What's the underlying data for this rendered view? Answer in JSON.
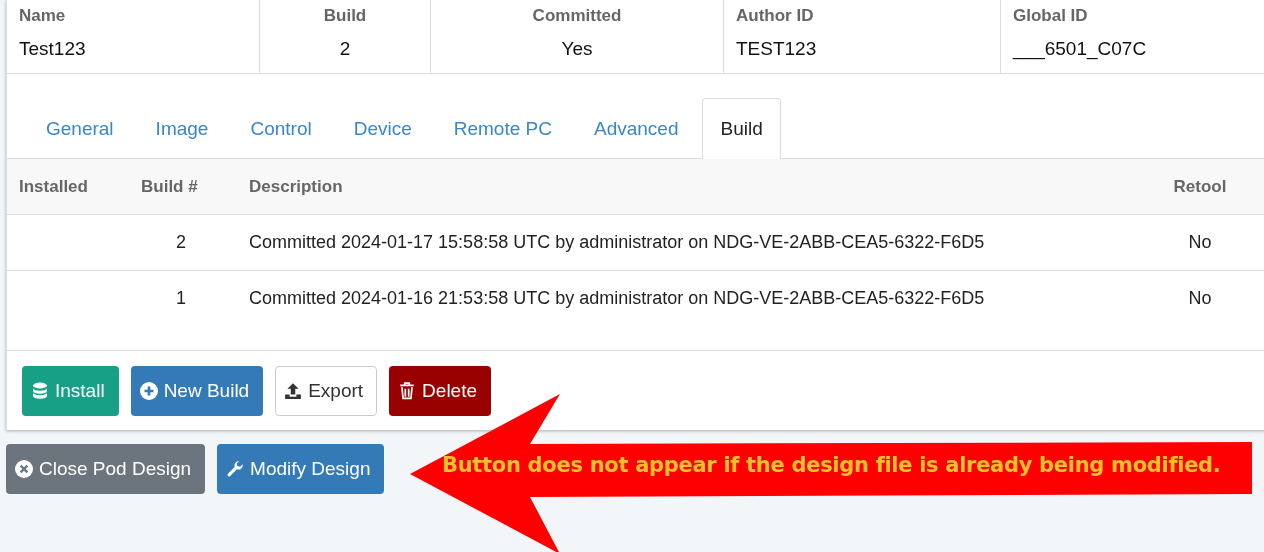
{
  "summary": {
    "columns": [
      {
        "label": "Name",
        "value": "Test123"
      },
      {
        "label": "Build",
        "value": "2"
      },
      {
        "label": "Committed",
        "value": "Yes"
      },
      {
        "label": "Author ID",
        "value": "TEST123"
      },
      {
        "label": "Global ID",
        "value": "___6501_C07C"
      }
    ]
  },
  "tabs": [
    {
      "label": "General",
      "selected": false
    },
    {
      "label": "Image",
      "selected": false
    },
    {
      "label": "Control",
      "selected": false
    },
    {
      "label": "Device",
      "selected": false
    },
    {
      "label": "Remote PC",
      "selected": false
    },
    {
      "label": "Advanced",
      "selected": false
    },
    {
      "label": "Build",
      "selected": true
    }
  ],
  "builds": {
    "columns": [
      "Installed",
      "Build #",
      "Description",
      "Retool"
    ],
    "rows": [
      {
        "installed": "",
        "build": "2",
        "description": "Committed 2024-01-17 15:58:58 UTC by administrator on NDG-VE-2ABB-CEA5-6322-F6D5",
        "retool": "No"
      },
      {
        "installed": "",
        "build": "1",
        "description": "Committed 2024-01-16 21:53:58 UTC by administrator on NDG-VE-2ABB-CEA5-6322-F6D5",
        "retool": "No"
      }
    ]
  },
  "build_actions": [
    {
      "label": "Install",
      "kind": "success"
    },
    {
      "label": "New Build",
      "kind": "primary"
    },
    {
      "label": "Export",
      "kind": "default"
    },
    {
      "label": "Delete",
      "kind": "danger"
    }
  ],
  "page_actions": [
    {
      "label": "Close Pod Design",
      "kind": "secondary"
    },
    {
      "label": "Modify Design",
      "kind": "primary"
    }
  ],
  "callout": {
    "text": "Button does not appear if the design file is already being modified."
  }
}
